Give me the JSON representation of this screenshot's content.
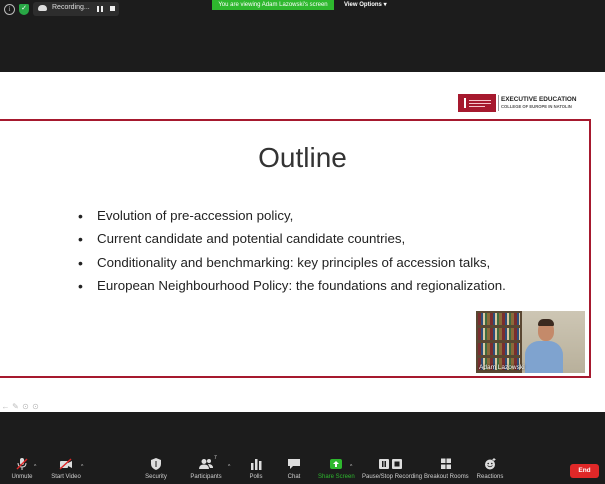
{
  "top_bar": {
    "recording_label": "Recording...",
    "viewing_banner": "You are viewing Adam Lazowski's screen",
    "view_options_label": "View Options",
    "view_options_caret": "▾",
    "info_glyph": "i",
    "shield_glyph": "✓",
    "icons": [
      "info-icon",
      "shield-icon",
      "cloud-recording-icon",
      "pause-icon",
      "stop-icon"
    ]
  },
  "slide": {
    "logo": {
      "line1": "EXECUTIVE EDUCATION",
      "line2": "COLLEGE OF EUROPE IN NATOLIN",
      "brand_color": "#a6192e"
    },
    "title": "Outline",
    "bullets": [
      "Evolution of pre-accession policy,",
      "Current candidate and potential candidate countries,",
      "Conditionality and benchmarking: key principles of accession talks,",
      "European Neighbourhood Policy: the foundations and regionalization."
    ],
    "frame_color": "#a6192e"
  },
  "video": {
    "participant_name": "Adam Lazowski"
  },
  "annotation_tools": {
    "glyphs": [
      "←",
      "✎",
      "⊙",
      "⊙",
      "→"
    ],
    "icons": [
      "arrow-left-icon",
      "pen-icon",
      "annotate-icon",
      "annotate-icon",
      "arrow-right-icon"
    ]
  },
  "toolbar": {
    "items": [
      {
        "label": "Unmute",
        "icon": "microphone-muted-icon"
      },
      {
        "label": "Start Video",
        "icon": "video-off-icon"
      },
      {
        "label": "Security",
        "icon": "shield-icon"
      },
      {
        "label": "Participants",
        "icon": "participants-icon",
        "count": "7"
      },
      {
        "label": "Polls",
        "icon": "polls-icon"
      },
      {
        "label": "Chat",
        "icon": "chat-icon"
      },
      {
        "label": "Share Screen",
        "icon": "share-screen-icon"
      },
      {
        "label": "Pause/Stop Recording",
        "icon": "pause-stop-recording-icon"
      },
      {
        "label": "Breakout Rooms",
        "icon": "breakout-rooms-icon"
      },
      {
        "label": "Reactions",
        "icon": "reactions-icon"
      }
    ],
    "end_label": "End",
    "caret": "^",
    "colors": {
      "share_screen": "#2eb82e",
      "end": "#e02828",
      "toolbar_bg": "#1c1c1c"
    }
  }
}
